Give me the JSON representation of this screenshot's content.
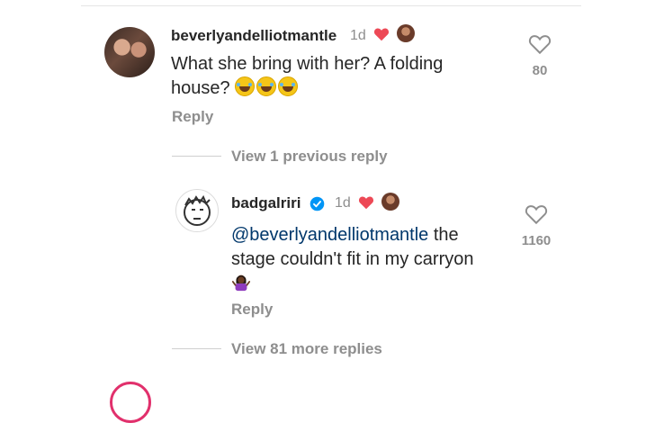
{
  "comments": [
    {
      "username": "beverlyandelliotmantle",
      "time": "1d",
      "text": "What she bring with her? A folding house?",
      "emoji": "😂😂😂",
      "reply_label": "Reply",
      "likes": "80",
      "liked_by_creator": true
    },
    {
      "username": "badgalriri",
      "verified": true,
      "time": "1d",
      "mention": "@beverlyandelliotmantle",
      "text": " the stage couldn't fit in my carryon",
      "emoji": "🤷🏿‍♀️",
      "reply_label": "Reply",
      "likes": "1160",
      "liked_by_creator": true
    }
  ],
  "thread": {
    "view_previous": "View 1 previous reply",
    "view_more": "View 81 more replies"
  },
  "colors": {
    "heart_red": "#ed4956",
    "verified_blue": "#0095f6",
    "mention_blue": "#00376b",
    "meta_gray": "#8e8e8e",
    "story_ring": "#e1306c"
  },
  "icons": [
    "heart-filled-icon",
    "verified-badge-icon",
    "heart-outline-icon"
  ]
}
